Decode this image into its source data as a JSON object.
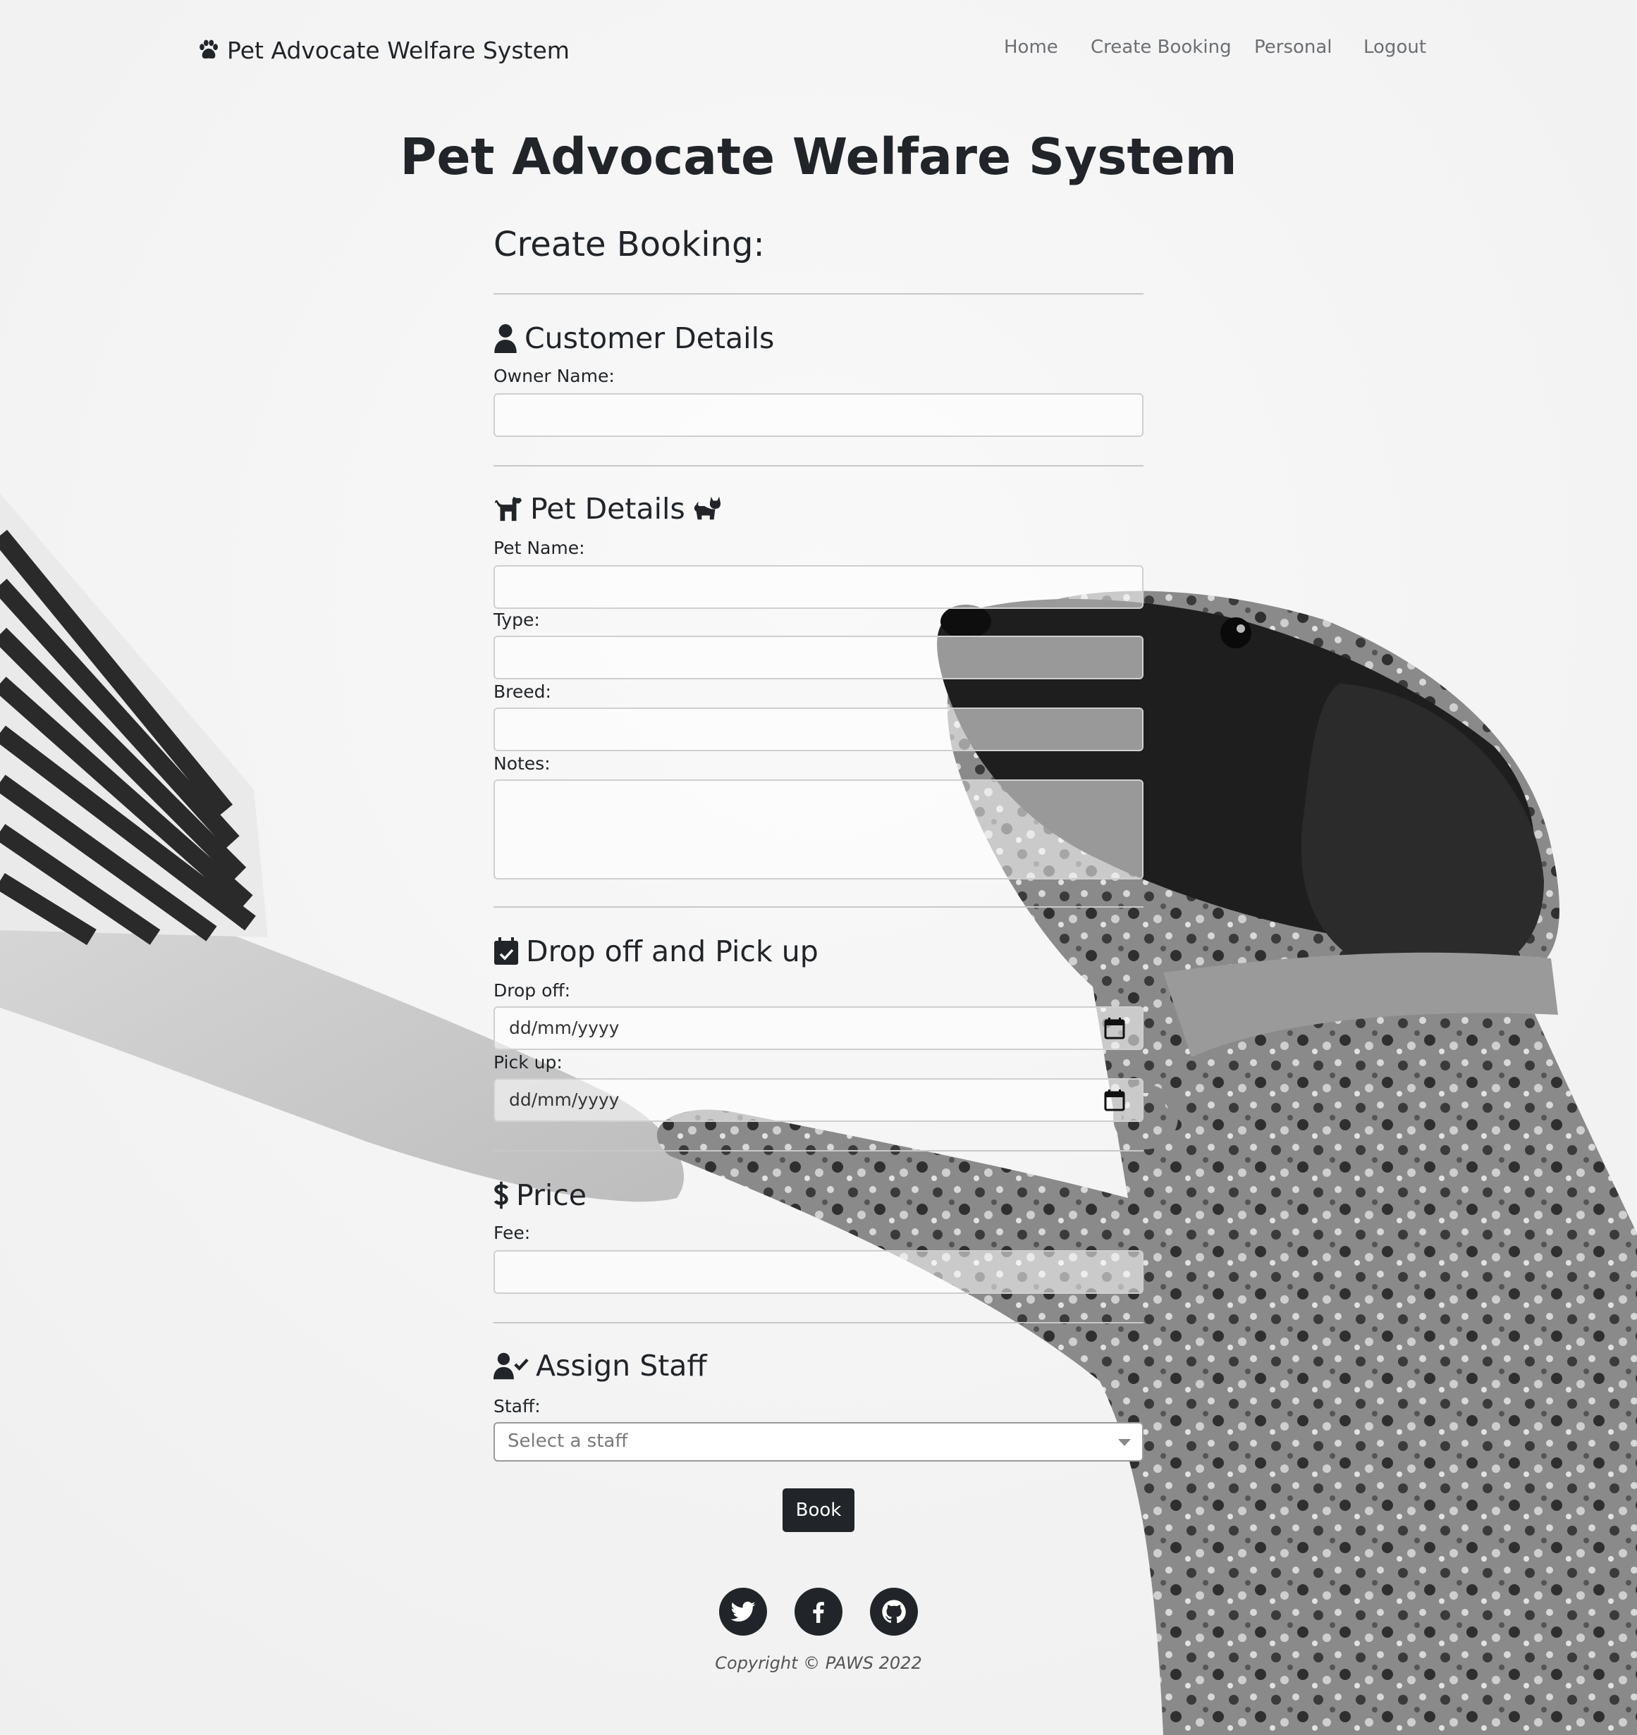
{
  "brand": {
    "text": "Pet Advocate Welfare System",
    "icon": "paw-icon"
  },
  "nav": {
    "items": [
      "Home",
      "Create Booking",
      "Personal",
      "Logout"
    ]
  },
  "page": {
    "title": "Pet Advocate Welfare System",
    "form_title": "Create Booking:"
  },
  "sections": {
    "customer": {
      "title": "Customer Details",
      "icon": "user-icon",
      "owner_label": "Owner Name:"
    },
    "pet": {
      "title": "Pet Details",
      "icons": [
        "dog-icon",
        "cat-icon"
      ],
      "name_label": "Pet Name:",
      "type_label": "Type:",
      "breed_label": "Breed:",
      "notes_label": "Notes:"
    },
    "schedule": {
      "title": "Drop off and Pick up",
      "icon": "calendar-check-icon",
      "dropoff_label": "Drop off:",
      "dropoff_placeholder": "dd/mm/yyyy",
      "pickup_label": "Pick up:",
      "pickup_placeholder": "dd/mm/yyyy"
    },
    "price": {
      "title": "Price",
      "icon": "dollar-icon",
      "fee_label": "Fee:"
    },
    "staff": {
      "title": "Assign Staff",
      "icon": "user-check-icon",
      "staff_label": "Staff:",
      "staff_placeholder": "Select a staff"
    }
  },
  "actions": {
    "book_label": "Book"
  },
  "footer": {
    "social_icons": [
      "twitter-icon",
      "facebook-icon",
      "github-icon"
    ],
    "copyright": "Copyright © PAWS 2022"
  },
  "colors": {
    "text": "#212529",
    "button": "#212529",
    "nav": "#6c6f73"
  }
}
